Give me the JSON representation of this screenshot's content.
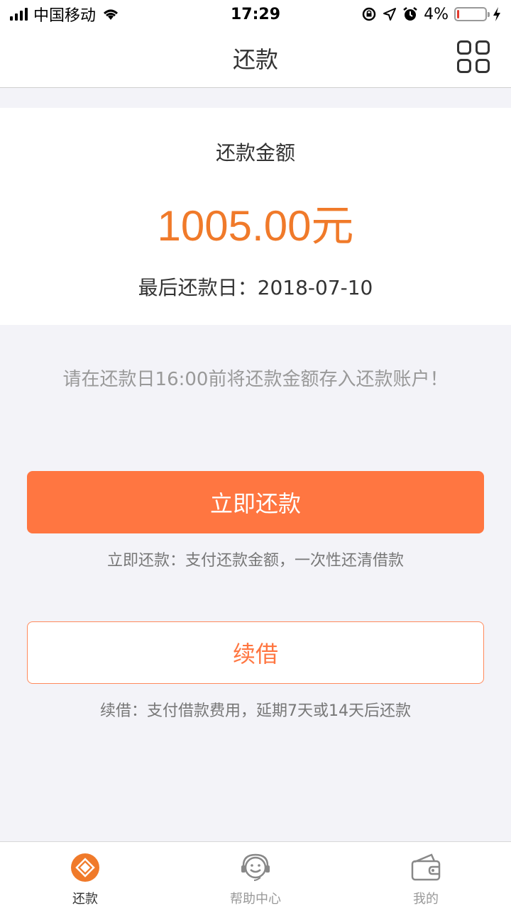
{
  "status_bar": {
    "carrier": "中国移动",
    "time": "17:29",
    "battery": "4%",
    "battery_level": 0.04
  },
  "nav": {
    "title": "还款"
  },
  "repayment": {
    "amount_label": "还款金额",
    "amount": "1005.00元",
    "due_label": "最后还款日：",
    "due_date": "2018-07-10",
    "notice": "请在还款日16:00前将还款金额存入还款账户！"
  },
  "actions": {
    "repay_now_label": "立即还款",
    "repay_now_desc": "立即还款：支付还款金额，一次性还清借款",
    "renew_label": "续借",
    "renew_desc": "续借：支付借款费用，延期7天或14天后还款"
  },
  "tabs": [
    {
      "label": "还款",
      "icon": "repay-icon",
      "active": true
    },
    {
      "label": "帮助中心",
      "icon": "help-center-icon",
      "active": false
    },
    {
      "label": "我的",
      "icon": "wallet-icon",
      "active": false
    }
  ],
  "colors": {
    "accent": "#ff7641",
    "amount": "#f07a2a"
  }
}
